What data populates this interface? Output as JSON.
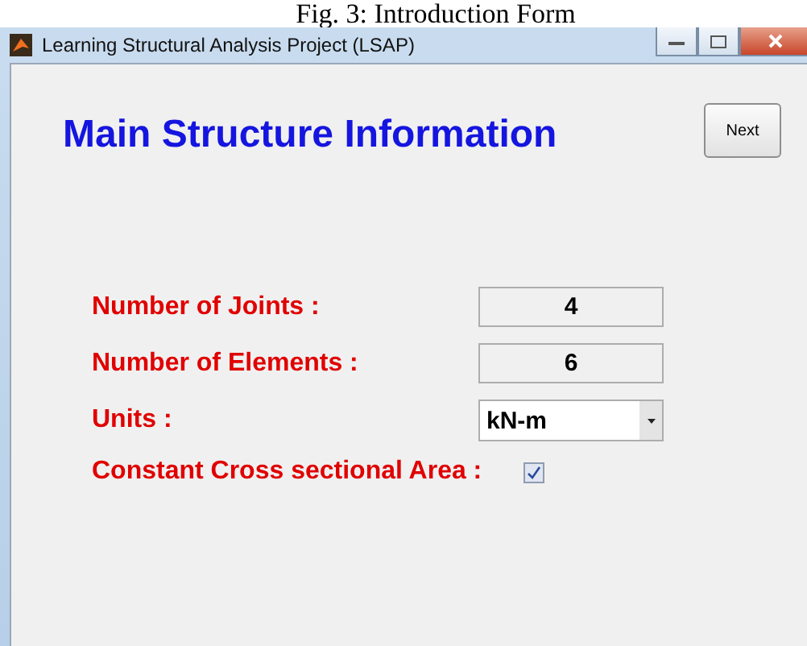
{
  "caption": "Fig. 3: Introduction Form",
  "window": {
    "title": "Learning Structural Analysis Project (LSAP)"
  },
  "heading": "Main Structure Information",
  "next_button": "Next",
  "fields": [
    {
      "kind": "text",
      "label": "Number of Joints :",
      "value": "4"
    },
    {
      "kind": "text",
      "label": "Number of Elements :",
      "value": "6"
    },
    {
      "kind": "select",
      "label": "Units :",
      "value": "kN-m"
    },
    {
      "kind": "checkbox",
      "label": "Constant Cross sectional Area :",
      "checked": true
    }
  ]
}
